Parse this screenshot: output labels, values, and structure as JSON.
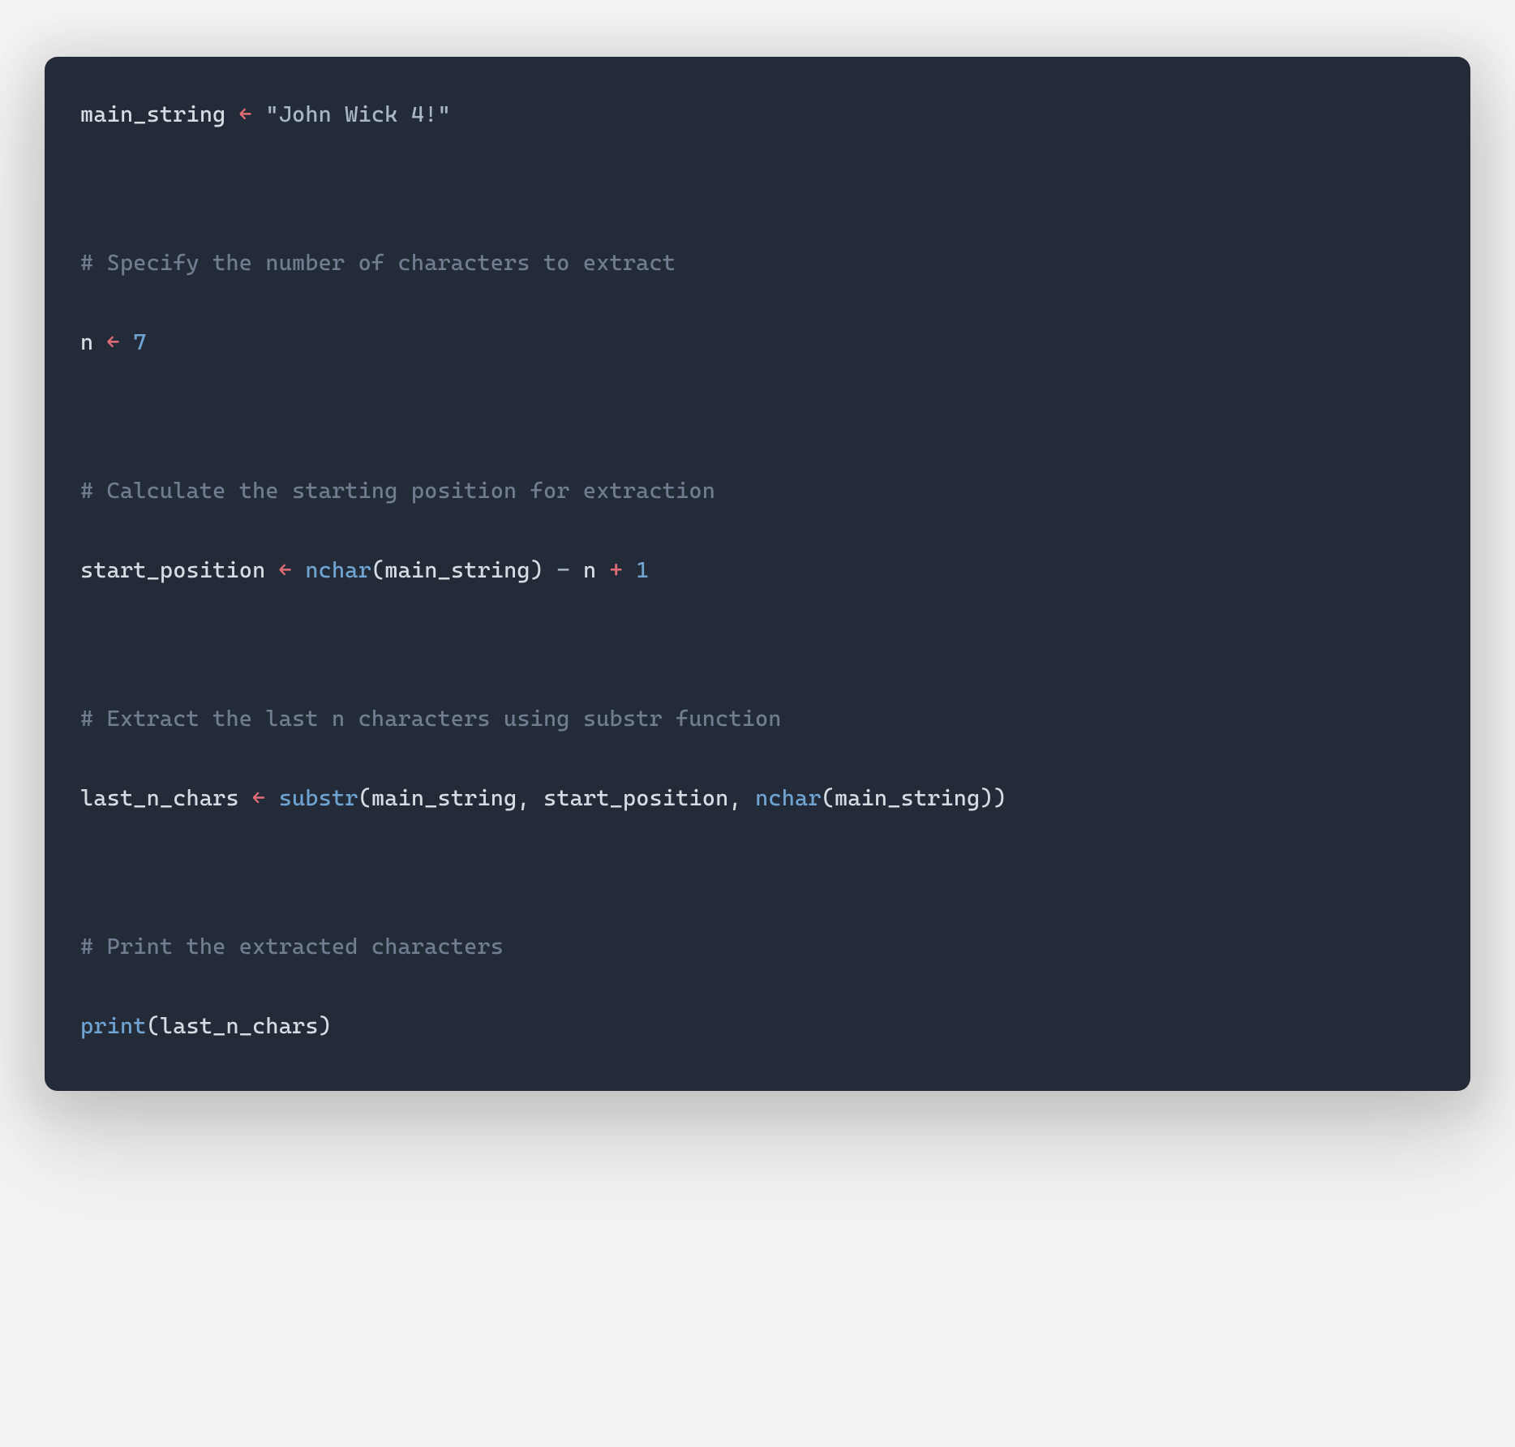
{
  "code": {
    "line1": {
      "var": "main_string",
      "assign": " ← ",
      "value": "\"John Wick 4!\""
    },
    "comment1": "# Specify the number of characters to extract",
    "line2": {
      "var": "n",
      "assign": " ← ",
      "value": "7"
    },
    "comment2": "# Calculate the starting position for extraction",
    "line3": {
      "var": "start_position",
      "assign": " ← ",
      "func": "nchar",
      "open": "(",
      "arg1": "main_string",
      "close": ")",
      "minus": " − ",
      "n": "n",
      "plus": " + ",
      "one": "1"
    },
    "comment3": "# Extract the last n characters using substr function",
    "line4": {
      "var": "last_n_chars",
      "assign": " ← ",
      "func1": "substr",
      "open1": "(",
      "a1": "main_string",
      "comma1": ", ",
      "a2": "start_position",
      "comma2": ", ",
      "func2": "nchar",
      "open2": "(",
      "a3": "main_string",
      "close2": ")",
      "close1": ")"
    },
    "comment4": "# Print the extracted characters",
    "line5": {
      "func": "print",
      "open": "(",
      "arg": "last_n_chars",
      "close": ")"
    }
  }
}
